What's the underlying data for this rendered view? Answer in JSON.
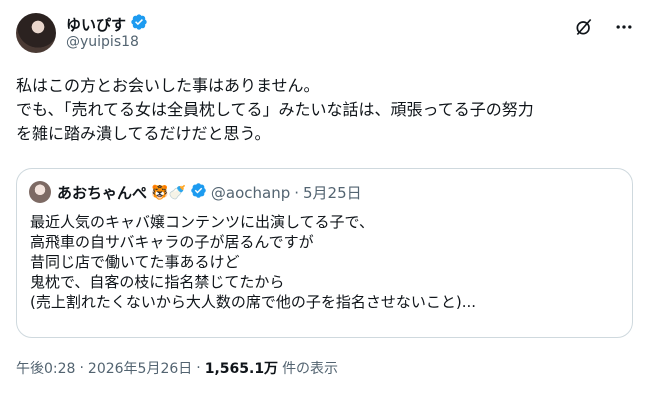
{
  "author": {
    "display_name": "ゆいぴす",
    "handle": "@yuipis18",
    "verified": true,
    "avatar_icon": "user-avatar"
  },
  "tweet": {
    "lines": [
      "私はこの方とお会いした事はありません。",
      "でも、「売れてる女は全員枕してる」みたいな話は、頑張ってる子の努力",
      "を雑に踏み潰してるだけだと思う。"
    ]
  },
  "quote": {
    "display_name": "あおちゃんぺ",
    "emoji": "🐯🍼",
    "verified": true,
    "handle": "@aochanp",
    "dot": "·",
    "date": "5月25日",
    "lines": [
      "最近人気のキャバ嬢コンテンツに出演してる子で、",
      "高飛車の自サバキャラの子が居るんですが",
      "昔同じ店で働いてた事あるけど",
      "鬼枕で、自客の枝に指名禁じてたから",
      "(売上割れたくないから大人数の席で他の子を指名させないこと)..."
    ]
  },
  "meta": {
    "time": "午後0:28",
    "sep1": "·",
    "date": "2026年5月26日",
    "sep2": "·",
    "views_count": "1,565.1万",
    "views_label": "件の表示"
  },
  "icons": {
    "verified_color": "#1d9bf0",
    "grok": "grok-icon",
    "more": "more-icon"
  }
}
